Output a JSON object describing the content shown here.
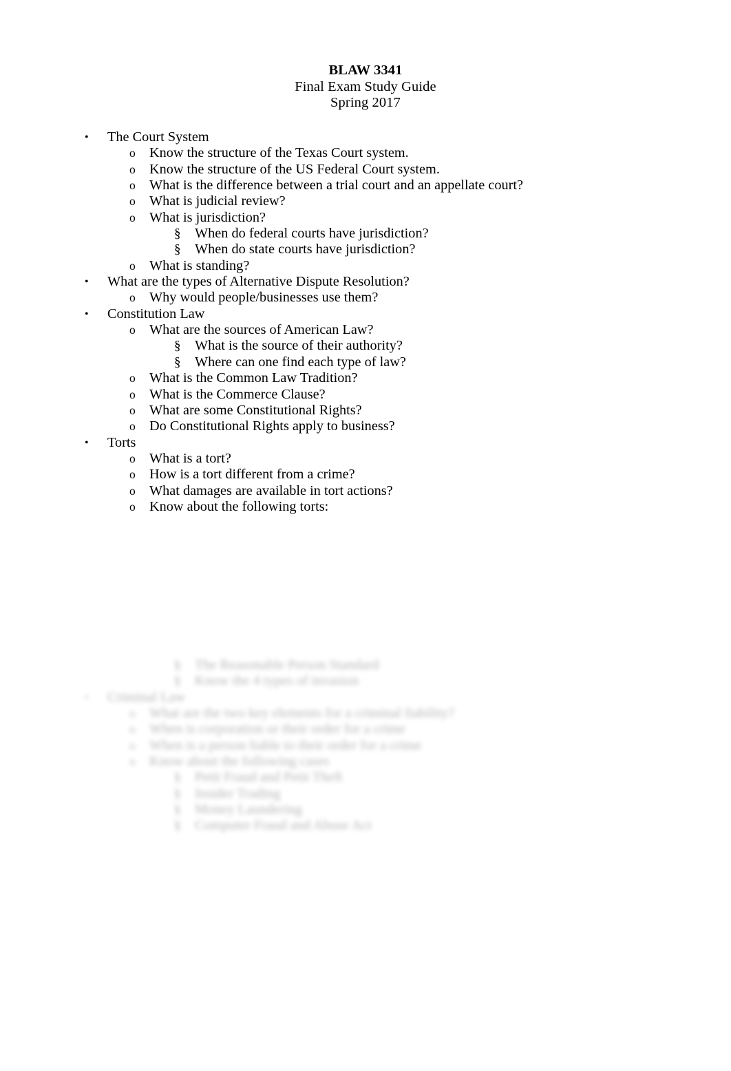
{
  "document": {
    "title_lines": [
      {
        "text": "BLAW 3341",
        "bold": true
      },
      {
        "text": "Final Exam Study Guide",
        "bold": false
      },
      {
        "text": "Spring 2017",
        "bold": false
      }
    ],
    "markers": {
      "level1": "•",
      "level2": "o",
      "level3": "§"
    },
    "outline": [
      {
        "level": 1,
        "text": "The Court System"
      },
      {
        "level": 2,
        "text": "Know the structure of the Texas Court system."
      },
      {
        "level": 2,
        "text": "Know the structure of the US Federal Court system."
      },
      {
        "level": 2,
        "text": "What is the difference between a trial court and an appellate court?"
      },
      {
        "level": 2,
        "text": "What is judicial review?"
      },
      {
        "level": 2,
        "text": "What is jurisdiction?"
      },
      {
        "level": 3,
        "text": "When do federal courts have jurisdiction?"
      },
      {
        "level": 3,
        "text": "When do state courts have jurisdiction?"
      },
      {
        "level": 2,
        "text": "What is standing?"
      },
      {
        "level": 1,
        "text": "What are the types of Alternative Dispute Resolution?"
      },
      {
        "level": 2,
        "text": "Why would people/businesses use them?"
      },
      {
        "level": 1,
        "text": "Constitution Law"
      },
      {
        "level": 2,
        "text": "What are the sources of American Law?"
      },
      {
        "level": 3,
        "text": "What is the source of their authority?"
      },
      {
        "level": 3,
        "text": "Where can one find each type of law?"
      },
      {
        "level": 2,
        "text": "What is the Common Law Tradition?"
      },
      {
        "level": 2,
        "text": "What is the Commerce Clause?"
      },
      {
        "level": 2,
        "text": "What are some Constitutional Rights?"
      },
      {
        "level": 2,
        "text": "Do Constitutional Rights apply to business?"
      },
      {
        "level": 1,
        "text": "Torts"
      },
      {
        "level": 2,
        "text": "What is a tort?"
      },
      {
        "level": 2,
        "text": "How is a tort different from a crime?"
      },
      {
        "level": 2,
        "text": "What damages are available in tort actions?"
      },
      {
        "level": 2,
        "text": "Know about the following torts:"
      }
    ],
    "obscured_outline": [
      {
        "level": 3,
        "text": "The Reasonable Person Standard"
      },
      {
        "level": 3,
        "text": "Know the 4 types of invasion"
      },
      {
        "level": 1,
        "text": "Criminal Law"
      },
      {
        "level": 2,
        "text": "What are the two key elements for a criminal liability?"
      },
      {
        "level": 2,
        "text": "When is corporation or their order for a crime"
      },
      {
        "level": 2,
        "text": "When is a person liable to their order for a crime"
      },
      {
        "level": 2,
        "text": "Know about the following cases"
      },
      {
        "level": 3,
        "text": "Petit Fraud and Petit Theft"
      },
      {
        "level": 3,
        "text": "Insider Trading"
      },
      {
        "level": 3,
        "text": "Money Laundering"
      },
      {
        "level": 3,
        "text": "Computer Fraud and Abuse Act"
      }
    ]
  }
}
